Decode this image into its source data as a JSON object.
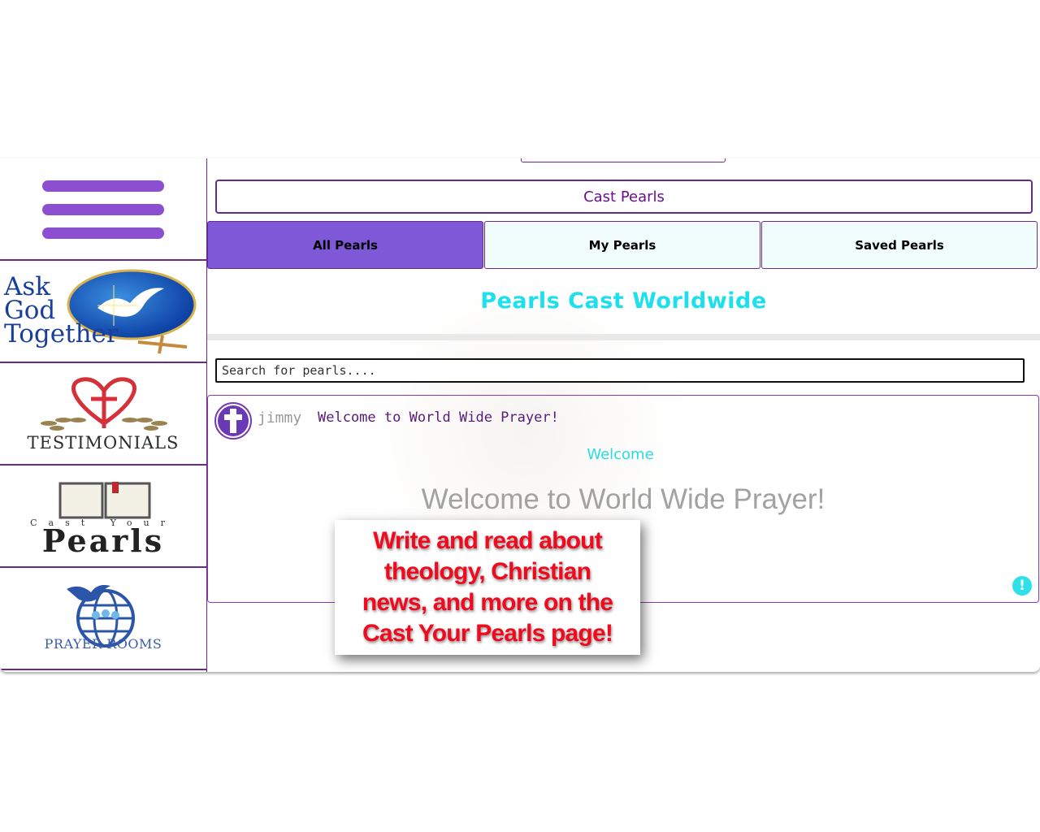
{
  "sidebar": {
    "tiles": [
      {
        "name": "Ask God Together",
        "lines": [
          "Ask",
          "God",
          "Together"
        ]
      },
      {
        "name": "Testimonials",
        "label": "TESTIMONIALS"
      },
      {
        "name": "Cast Your Pearls",
        "top": "Cast Your",
        "bottom": "Pearls"
      },
      {
        "name": "Prayer Rooms",
        "label": "PRAYER ROOMS"
      }
    ]
  },
  "main": {
    "cast_button": "Cast Pearls",
    "tabs": [
      {
        "label": "All Pearls",
        "active": true
      },
      {
        "label": "My Pearls",
        "active": false
      },
      {
        "label": "Saved Pearls",
        "active": false
      }
    ],
    "heading": "Pearls Cast Worldwide",
    "search": {
      "placeholder": "Search for pearls...."
    },
    "post": {
      "author": "jimmy",
      "title": "Welcome to World Wide Prayer!",
      "subtitle": "Welcome",
      "body": "Welcome to World Wide Prayer!"
    }
  },
  "callout": {
    "text": "Write and read about\ntheology, Christian\nnews, and more on the\nCast Your Pearls page!"
  },
  "colors": {
    "accent_purple": "#7e58d6",
    "border_purple": "#6a2a8a",
    "heading_cyan": "#1ee0ea",
    "callout_red": "#f00a1e"
  }
}
